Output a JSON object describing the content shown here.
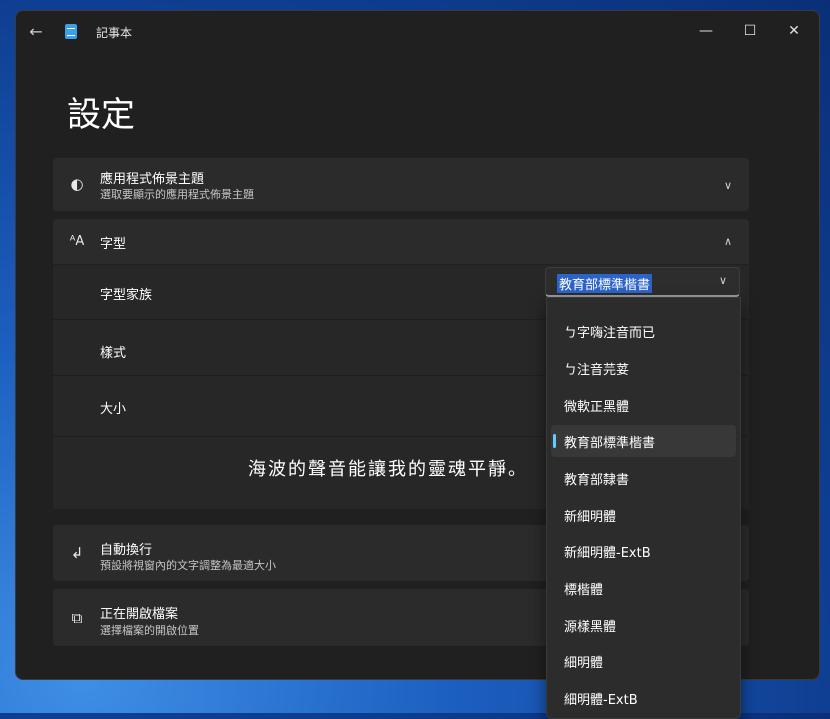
{
  "window": {
    "title": "記事本"
  },
  "page": {
    "title": "設定"
  },
  "theme_card": {
    "title": "應用程式佈景主題",
    "subtitle": "選取要顯示的應用程式佈景主題"
  },
  "font_card": {
    "title": "字型",
    "family_label": "字型家族",
    "style_label": "樣式",
    "size_label": "大小",
    "selected_family": "教育部標準楷書",
    "preview_text": "海波的聲音能讓我的靈魂平靜。"
  },
  "font_options": [
    "ㄅ字嗨注音而已",
    "ㄅ注音芫荽",
    "微軟正黑體",
    "教育部標準楷書",
    "教育部隸書",
    "新細明體",
    "新細明體-ExtB",
    "標楷體",
    "源樣黑體",
    "細明體",
    "細明體-ExtB"
  ],
  "selected_index": 3,
  "wrap_card": {
    "title": "自動換行",
    "subtitle": "預設將視窗內的文字調整為最適大小"
  },
  "open_card": {
    "title": "正在開啟檔案",
    "subtitle": "選擇檔案的開啟位置"
  },
  "colors": {
    "accent": "#60cdff",
    "selection": "#2c63c7"
  }
}
